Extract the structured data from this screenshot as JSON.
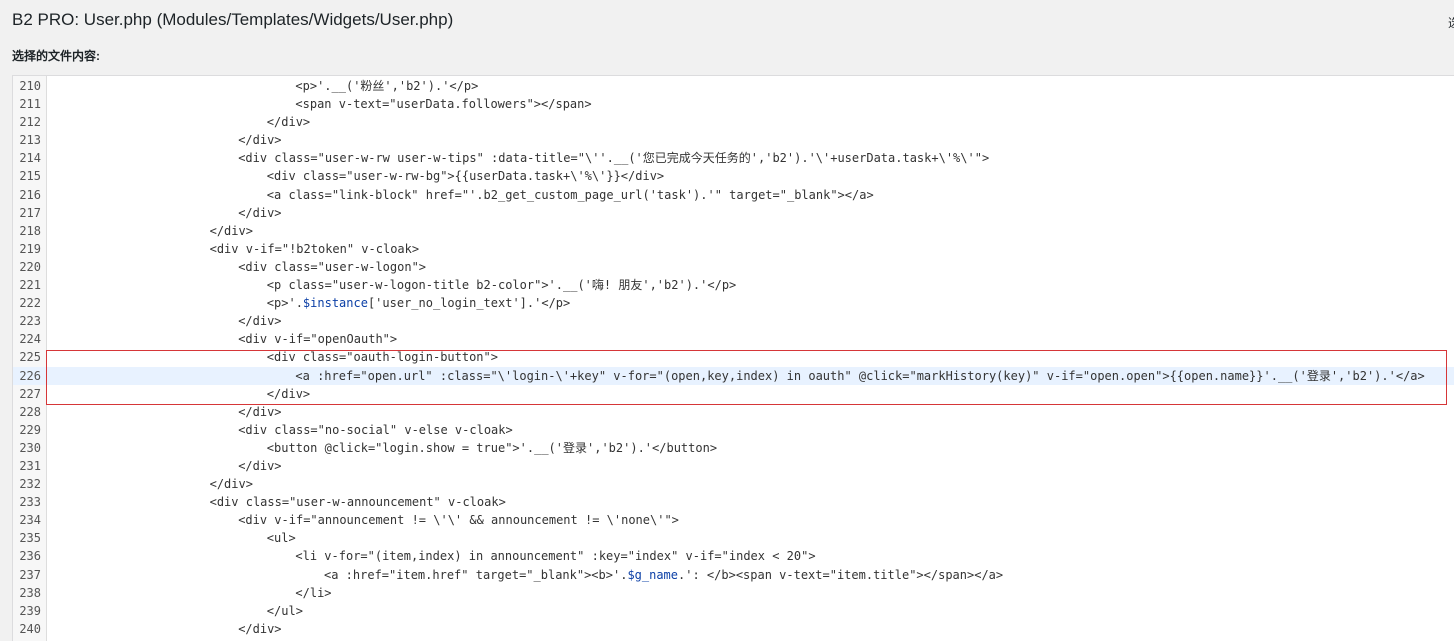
{
  "header": {
    "title": "B2 PRO: User.php (Modules/Templates/Widgets/User.php)",
    "corner_text": "选"
  },
  "editor": {
    "label": "选择的文件内容:",
    "active_line": 226,
    "highlight_range": [
      225,
      227
    ],
    "lines": [
      {
        "num": "210",
        "indent": 9,
        "text": "<p>'.__('粉丝','b2').'</p>"
      },
      {
        "num": "211",
        "indent": 9,
        "text": "<span v-text=\"userData.followers\"></span>"
      },
      {
        "num": "212",
        "indent": 8,
        "text": "</div>"
      },
      {
        "num": "213",
        "indent": 7,
        "text": "</div>"
      },
      {
        "num": "214",
        "indent": 7,
        "text": "<div class=\"user-w-rw user-w-tips\" :data-title=\"\\''.__('您已完成今天任务的','b2').'\\'+userData.task+\\'%\\'\">"
      },
      {
        "num": "215",
        "indent": 8,
        "text": "<div class=\"user-w-rw-bg\">{{userData.task+\\'%\\'}}</div>"
      },
      {
        "num": "216",
        "indent": 8,
        "text": "<a class=\"link-block\" href=\"'.b2_get_custom_page_url('task').'\" target=\"_blank\"></a>"
      },
      {
        "num": "217",
        "indent": 7,
        "text": "</div>"
      },
      {
        "num": "218",
        "indent": 6,
        "text": "</div>"
      },
      {
        "num": "219",
        "indent": 6,
        "text": "<div v-if=\"!b2token\" v-cloak>"
      },
      {
        "num": "220",
        "indent": 7,
        "text": "<div class=\"user-w-logon\">"
      },
      {
        "num": "221",
        "indent": 8,
        "text": "<p class=\"user-w-logon-title b2-color\">'.__('嗨! 朋友','b2').'</p>"
      },
      {
        "num": "222",
        "indent": 8,
        "pre": "<p>'.",
        "var": "$instance",
        "post": "['user_no_login_text'].'</p>"
      },
      {
        "num": "223",
        "indent": 7,
        "text": "</div>"
      },
      {
        "num": "224",
        "indent": 7,
        "text": "<div v-if=\"openOauth\">"
      },
      {
        "num": "225",
        "indent": 8,
        "text": "<div class=\"oauth-login-button\">"
      },
      {
        "num": "226",
        "indent": 9,
        "text": "<a :href=\"open.url\" :class=\"\\'login-\\'+key\" v-for=\"(open,key,index) in oauth\" @click=\"markHistory(key)\" v-if=\"open.open\">{{open.name}}'.__('登录','b2').'</a>"
      },
      {
        "num": "227",
        "indent": 8,
        "text": "</div>"
      },
      {
        "num": "228",
        "indent": 7,
        "text": "</div>"
      },
      {
        "num": "229",
        "indent": 7,
        "text": "<div class=\"no-social\" v-else v-cloak>"
      },
      {
        "num": "230",
        "indent": 8,
        "text": "<button @click=\"login.show = true\">'.__('登录','b2').'</button>"
      },
      {
        "num": "231",
        "indent": 7,
        "text": "</div>"
      },
      {
        "num": "232",
        "indent": 6,
        "text": "</div>"
      },
      {
        "num": "233",
        "indent": 6,
        "text": "<div class=\"user-w-announcement\" v-cloak>"
      },
      {
        "num": "234",
        "indent": 7,
        "text": "<div v-if=\"announcement != \\'\\' && announcement != \\'none\\'\">"
      },
      {
        "num": "235",
        "indent": 8,
        "text": "<ul>"
      },
      {
        "num": "236",
        "indent": 9,
        "text": "<li v-for=\"(item,index) in announcement\" :key=\"index\" v-if=\"index < 20\">"
      },
      {
        "num": "237",
        "indent": 10,
        "pre": "<a :href=\"item.href\" target=\"_blank\"><b>'.",
        "var": "$g_name",
        "post": ".': </b><span v-text=\"item.title\"></span></a>"
      },
      {
        "num": "238",
        "indent": 9,
        "text": "</li>"
      },
      {
        "num": "239",
        "indent": 8,
        "text": "</ul>"
      },
      {
        "num": "240",
        "indent": 7,
        "text": "</div>"
      }
    ]
  }
}
